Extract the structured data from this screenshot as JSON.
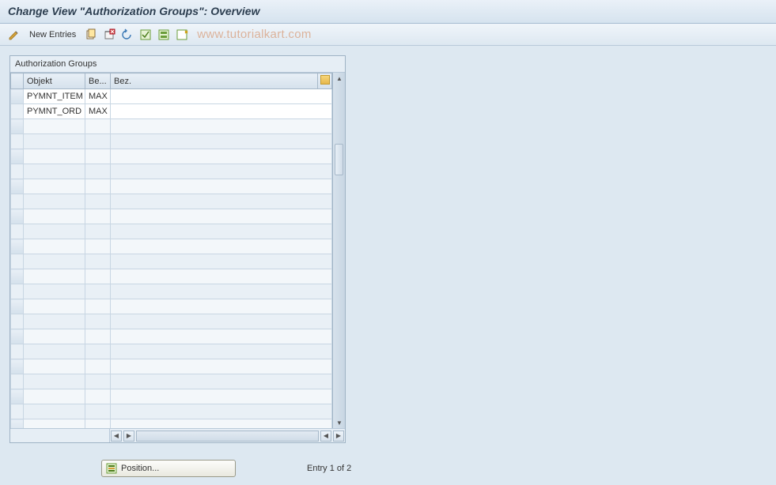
{
  "title": "Change View \"Authorization Groups\": Overview",
  "toolbar": {
    "new_entries_label": "New Entries"
  },
  "watermark": "www.tutorialkart.com",
  "panel": {
    "title": "Authorization Groups",
    "columns": {
      "objekt": "Objekt",
      "be": "Be...",
      "bez": "Bez."
    },
    "rows": [
      {
        "objekt": "PYMNT_ITEM",
        "be": "MAX",
        "bez": ""
      },
      {
        "objekt": "PYMNT_ORD",
        "be": "MAX",
        "bez": ""
      }
    ],
    "empty_row_count": 21
  },
  "footer": {
    "position_label": "Position...",
    "entry_label": "Entry 1 of 2"
  }
}
